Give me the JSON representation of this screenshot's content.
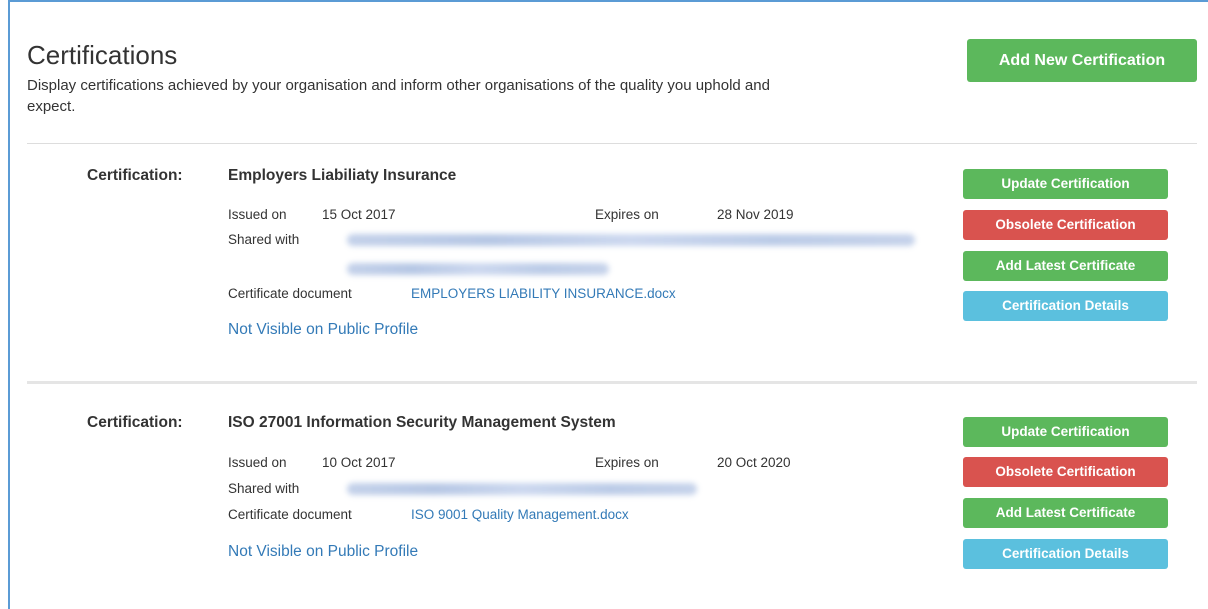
{
  "header": {
    "title": "Certifications",
    "subtitle": "Display certifications achieved by your organisation and inform other organisations of the quality you uphold and expect.",
    "add_button": "Add New Certification"
  },
  "labels": {
    "certification": "Certification:",
    "issued_on": "Issued on",
    "expires_on": "Expires on",
    "shared_with": "Shared with",
    "certificate_document": "Certificate document"
  },
  "buttons": {
    "update": "Update Certification",
    "obsolete": "Obsolete Certification",
    "add_latest": "Add Latest Certificate",
    "details": "Certification Details"
  },
  "certifications": [
    {
      "name": "Employers Liabiliaty Insurance",
      "issued_on": "15 Oct 2017",
      "expires_on": "28 Nov 2019",
      "document": "EMPLOYERS LIABILITY INSURANCE.docx",
      "visibility": "Not Visible on Public Profile"
    },
    {
      "name": "ISO 27001 Information Security Management System",
      "issued_on": "10 Oct 2017",
      "expires_on": "20 Oct 2020",
      "document": "ISO 9001 Quality Management.docx",
      "visibility": "Not Visible on Public Profile"
    }
  ],
  "colors": {
    "success": "#5cb85c",
    "danger": "#d9534f",
    "info": "#5bc0de",
    "link": "#337ab7"
  }
}
